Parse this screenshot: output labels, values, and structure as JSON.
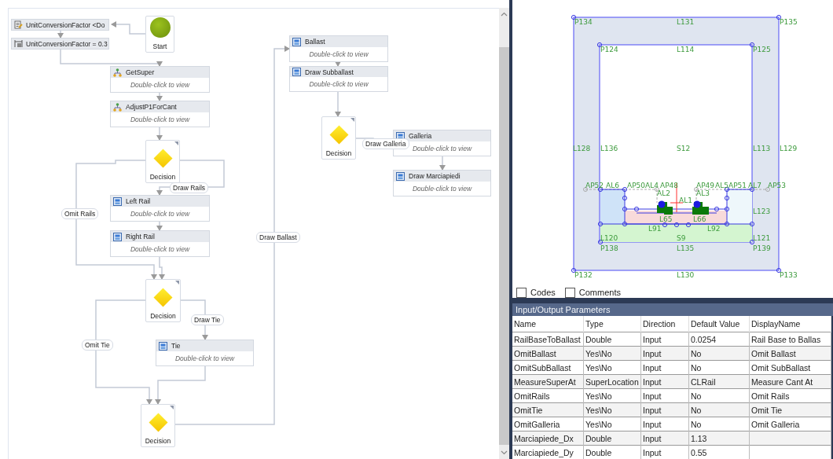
{
  "flowchart": {
    "nodes": [
      {
        "kind": "assign",
        "title": "UnitConversionFactor <Do"
      },
      {
        "kind": "assign",
        "title": "UnitConversionFactor = 0.3"
      },
      {
        "kind": "start",
        "title": "Start"
      },
      {
        "kind": "sequence",
        "title": "GetSuper",
        "hint": "Double-click to view"
      },
      {
        "kind": "sequence",
        "title": "AdjustP1ForCant",
        "hint": "Double-click to view"
      },
      {
        "kind": "decision",
        "title": "Decision"
      },
      {
        "kind": "activity",
        "title": "Left Rail",
        "hint": "Double-click to view"
      },
      {
        "kind": "activity",
        "title": "Right Rail",
        "hint": "Double-click to view"
      },
      {
        "kind": "decision",
        "title": "Decision"
      },
      {
        "kind": "activity",
        "title": "Tie",
        "hint": "Double-click to view"
      },
      {
        "kind": "decision",
        "title": "Decision"
      },
      {
        "kind": "activity",
        "title": "Ballast",
        "hint": "Double-click to view"
      },
      {
        "kind": "activity",
        "title": "Draw Subballast",
        "hint": "Double-click to view"
      },
      {
        "kind": "decision",
        "title": "Decision"
      },
      {
        "kind": "activity",
        "title": "Galleria",
        "hint": "Double-click to view"
      },
      {
        "kind": "activity",
        "title": "Draw Marciapiedi",
        "hint": "Double-click to view"
      }
    ],
    "edge_labels": [
      "Draw Rails",
      "Omit Rails",
      "Draw Tie",
      "Omit Tie",
      "Draw Ballast",
      "Draw Galleria"
    ]
  },
  "geometry": {
    "labels": [
      "P134",
      "L131",
      "P135",
      "P124",
      "L114",
      "P125",
      "L128",
      "L136",
      "S12",
      "L113",
      "L129",
      "AP52",
      "AL6",
      "AP50",
      "AL4",
      "AP48",
      "AP49",
      "AL5",
      "AP51",
      "AL7",
      "AP53",
      "AL2",
      "AL3",
      "AL1",
      "L123",
      "L65",
      "L66",
      "L91",
      "L92",
      "L120",
      "S9",
      "L121",
      "P138",
      "L135",
      "P139",
      "P132",
      "L130",
      "P133"
    ]
  },
  "options": [
    {
      "label": "Codes",
      "checked": false
    },
    {
      "label": "Comments",
      "checked": false
    }
  ],
  "parameters": {
    "title": "Input/Output Parameters",
    "columns": [
      "Name",
      "Type",
      "Direction",
      "Default Value",
      "DisplayName"
    ],
    "rows": [
      {
        "name": "RailBaseToBallast",
        "type": "Double",
        "direction": "Input",
        "default_value": "0.0254",
        "display_name": "Rail Base to Ballas"
      },
      {
        "name": "OmitBallast",
        "type": "Yes\\No",
        "direction": "Input",
        "default_value": "No",
        "display_name": "Omit Ballast"
      },
      {
        "name": "OmitSubBallast",
        "type": "Yes\\No",
        "direction": "Input",
        "default_value": "No",
        "display_name": "Omit SubBallast"
      },
      {
        "name": "MeasureSuperAt",
        "type": "SuperLocation",
        "direction": "Input",
        "default_value": "CLRail",
        "display_name": "Measure Cant At"
      },
      {
        "name": "OmitRails",
        "type": "Yes\\No",
        "direction": "Input",
        "default_value": "No",
        "display_name": "Omit Rails"
      },
      {
        "name": "OmitTie",
        "type": "Yes\\No",
        "direction": "Input",
        "default_value": "No",
        "display_name": "Omit Tie"
      },
      {
        "name": "OmitGalleria",
        "type": "Yes\\No",
        "direction": "Input",
        "default_value": "No",
        "display_name": "Omit Galleria"
      },
      {
        "name": "Marciapiede_Dx",
        "type": "Double",
        "direction": "Input",
        "default_value": "1.13"
      },
      {
        "name": "Marciapiede_Dy",
        "type": "Double",
        "direction": "Input",
        "default_value": "0.55"
      }
    ]
  }
}
